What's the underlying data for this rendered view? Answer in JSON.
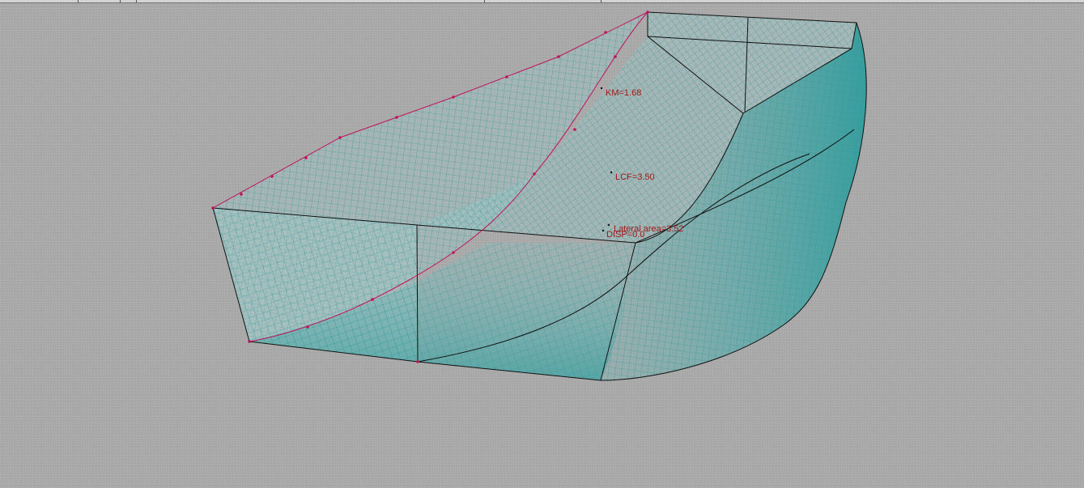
{
  "app": {
    "view": "hull-3d-wireframe"
  },
  "colors": {
    "background": "#a9a9a9",
    "mesh": "#3aa0a0",
    "mesh_fill": "#6fb9b9",
    "edges": "#111111",
    "control_points": "#c0145a",
    "labels": "#a01818"
  },
  "hydrostatics": {
    "km_label": "KM=1.68",
    "lcf_label": "LCF=3.50",
    "lateral_area_label": "Lateral area=3.52",
    "displacement_label": "DISP=0.0"
  }
}
